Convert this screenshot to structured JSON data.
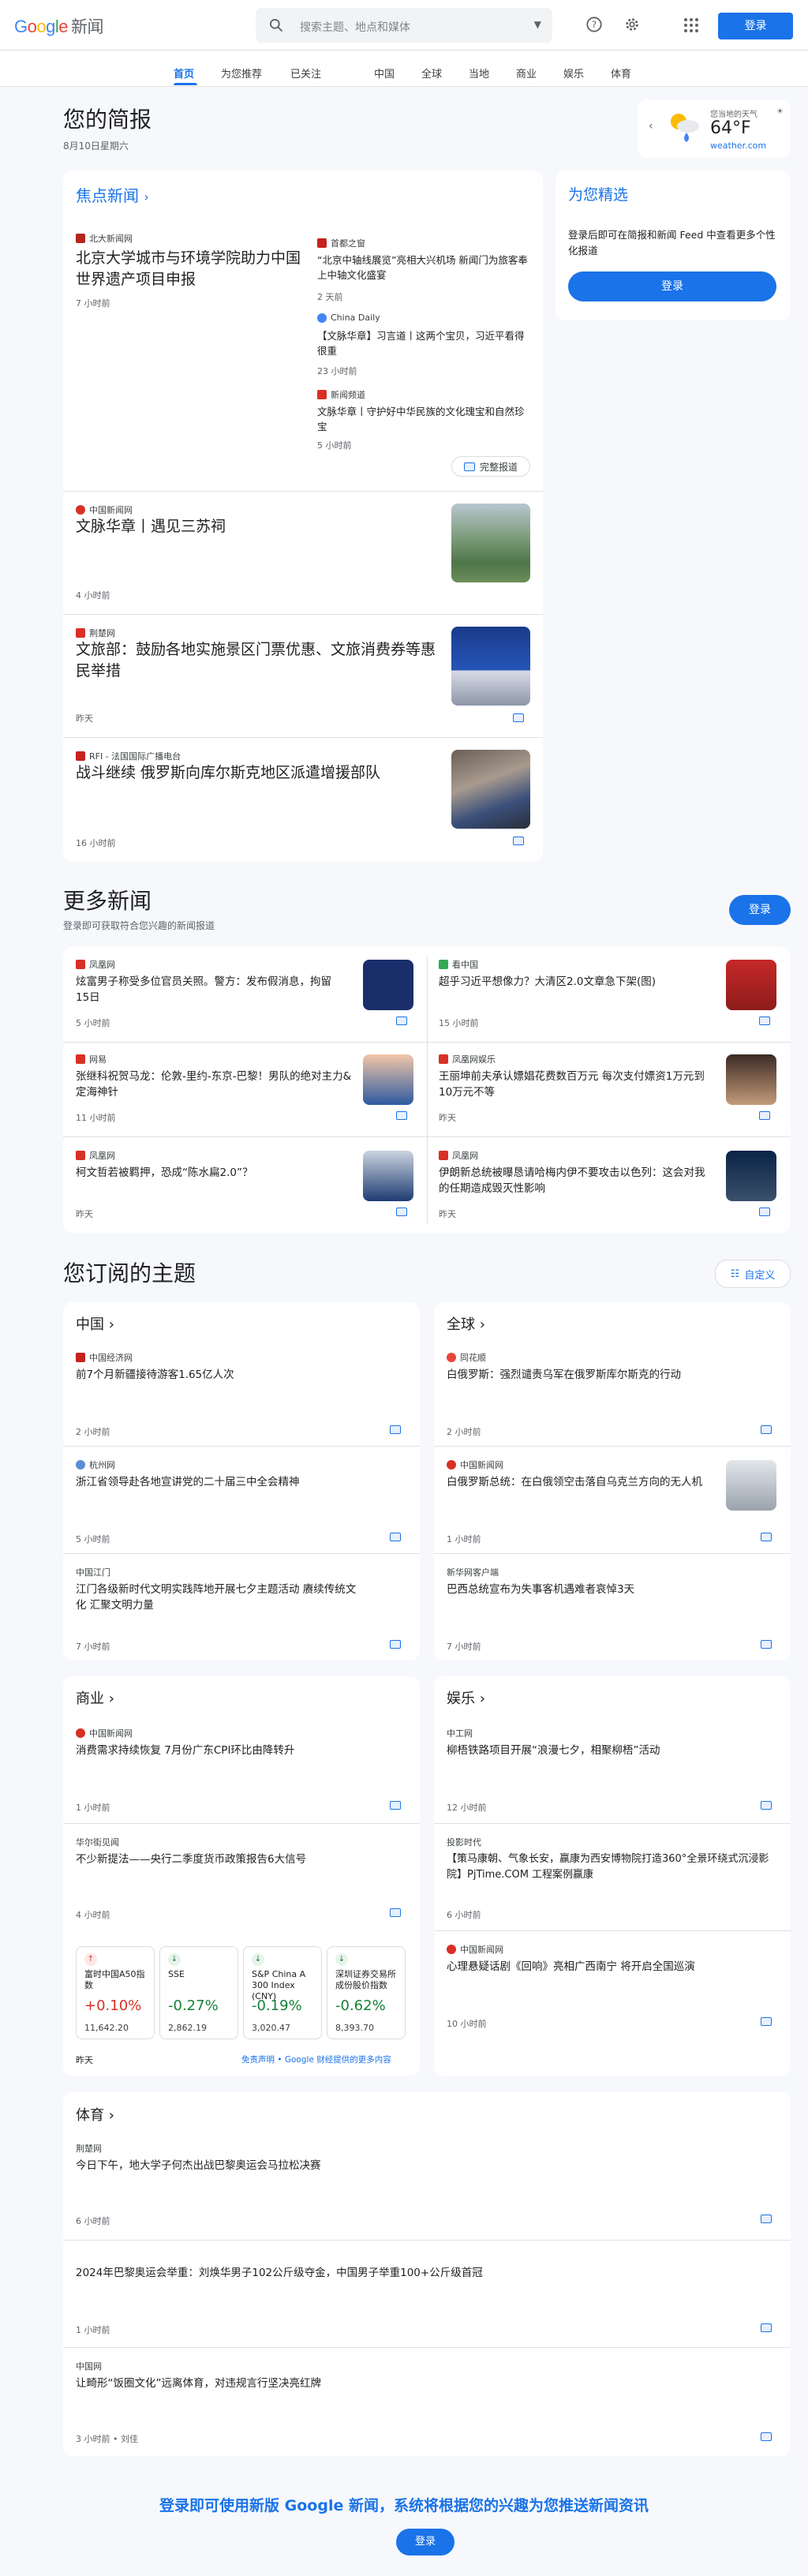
{
  "header": {
    "logo_google": "Google",
    "logo_news": "新闻",
    "search_placeholder": "搜索主题、地点和媒体",
    "signin": "登录"
  },
  "nav": {
    "tabs": [
      "首页",
      "为您推荐",
      "已关注",
      "中国",
      "全球",
      "当地",
      "商业",
      "娱乐",
      "体育"
    ]
  },
  "briefing": {
    "title": "您的简报",
    "date": "8月10日星期六"
  },
  "weather": {
    "label": "您当地的天气",
    "temp": "64°F",
    "source": "weather.com"
  },
  "headlines": {
    "title": "焦点新闻",
    "main": {
      "source": "北大新闻网",
      "title": "北京大学城市与环境学院助力中国世界遗产项目申报",
      "time": "7 小时前"
    },
    "side": [
      {
        "source": "首都之窗",
        "title": "“北京中轴线展览”亮相大兴机场 新闻门为旅客奉上中轴文化盛宴",
        "time": "2 天前"
      },
      {
        "source": "China Daily",
        "title": "【文脉华章】习言道丨这两个宝贝，习近平看得很重",
        "time": "23 小时前"
      },
      {
        "source": "新闻频道",
        "title": "文脉华章丨守护好中华民族的文化瑰宝和自然珍宝",
        "time": "5 小时前"
      }
    ],
    "full_coverage": "完整报道",
    "items": [
      {
        "source": "中国新闻网",
        "title": "文脉华章丨遇见三苏祠",
        "time": "4 小时前"
      },
      {
        "source": "荆楚网",
        "title": "文旅部：鼓励各地实施景区门票优惠、文旅消费券等惠民举措",
        "time": "昨天"
      },
      {
        "source": "RFI - 法国国际广播电台",
        "title": "战斗继续 俄罗斯向库尔斯克地区派遣增援部队",
        "time": "16 小时前"
      }
    ]
  },
  "picks": {
    "title": "为您精选",
    "desc": "登录后即可在简报和新闻 Feed 中查看更多个性化报道",
    "signin": "登录"
  },
  "more": {
    "title": "更多新闻",
    "sub": "登录即可获取符合您兴趣的新闻报道",
    "signin": "登录",
    "items": [
      {
        "source": "凤凰网",
        "title": "炫富男子称受多位官员关照。警方：发布假消息，拘留15日",
        "time": "5 小时前"
      },
      {
        "source": "看中国",
        "title": "超乎习近平想像力？大清区2.0文章急下架(图)",
        "time": "15 小时前"
      },
      {
        "source": "网易",
        "title": "张继科祝贺马龙：伦敦-里约-东京-巴黎！男队的绝对主力&定海神针",
        "time": "11 小时前"
      },
      {
        "source": "凤凰网娱乐",
        "title": "王丽坤前夫承认嫖娼花费数百万元 每次支付嫖资1万元到10万元不等",
        "time": "昨天"
      },
      {
        "source": "凤凰网",
        "title": "柯文哲若被羁押，恐成“陈水扁2.0”？",
        "time": "昨天"
      },
      {
        "source": "凤凰网",
        "title": "伊朗新总统被曝恳请哈梅内伊不要攻击以色列：这会对我的任期造成毁灭性影响",
        "time": "昨天"
      }
    ]
  },
  "topics": {
    "title": "您订阅的主题",
    "customize": "自定义",
    "china": {
      "title": "中国",
      "items": [
        {
          "source": "中国经济网",
          "title": "前7个月新疆接待游客1.65亿人次",
          "time": "2 小时前"
        },
        {
          "source": "杭州网",
          "title": "浙江省领导赴各地宣讲党的二十届三中全会精神",
          "time": "5 小时前"
        },
        {
          "source": "中国江门",
          "title": "江门各级新时代文明实践阵地开展七夕主题活动 赓续传统文化 汇聚文明力量",
          "time": "7 小时前"
        }
      ]
    },
    "world": {
      "title": "全球",
      "items": [
        {
          "source": "同花顺",
          "title": "白俄罗斯：强烈谴责乌军在俄罗斯库尔斯克的行动",
          "time": "2 小时前"
        },
        {
          "source": "中国新闻网",
          "title": "白俄罗斯总统：在白俄领空击落自乌克兰方向的无人机",
          "time": "1 小时前"
        },
        {
          "source": "新华网客户端",
          "title": "巴西总统宣布为失事客机遇难者哀悼3天",
          "time": "7 小时前"
        }
      ]
    },
    "business": {
      "title": "商业",
      "items": [
        {
          "source": "中国新闻网",
          "title": "消费需求持续恢复 7月份广东CPI环比由降转升",
          "time": "1 小时前"
        },
        {
          "source": "华尔街见闻",
          "title": "不少新提法——央行二季度货币政策报告6大信号",
          "time": "4 小时前"
        }
      ],
      "stocks": [
        {
          "name": "富时中国A50指数",
          "pct": "+0.10%",
          "value": "11,642.20",
          "dir": "up"
        },
        {
          "name": "SSE",
          "pct": "-0.27%",
          "value": "2,862.19",
          "dir": "down"
        },
        {
          "name": "S&P China A 300 Index (CNY)",
          "pct": "-0.19%",
          "value": "3,020.47",
          "dir": "down"
        },
        {
          "name": "深圳证券交易所成份股价指数",
          "pct": "-0.62%",
          "value": "8,393.70",
          "dir": "down"
        }
      ],
      "stock_time": "昨天",
      "disclaimer": "免责声明 • Google 财经提供的更多内容"
    },
    "ent": {
      "title": "娱乐",
      "items": [
        {
          "source": "中工网",
          "title": "柳梧铁路项目开展“浪漫七夕，相聚柳梧”活动",
          "time": "12 小时前"
        },
        {
          "source": "投影时代",
          "title": "【策马康朝、气象长安，赢康为西安博物院打造360°全景环绕式沉浸影院】PjTime.COM 工程案例赢康",
          "time": "6 小时前"
        },
        {
          "source": "中国新闻网",
          "title": "心理悬疑话剧《回响》亮相广西南宁 将开启全国巡演",
          "time": "10 小时前"
        }
      ]
    },
    "sports": {
      "title": "体育",
      "items": [
        {
          "source": "荆楚网",
          "title": "今日下午，地大学子何杰出战巴黎奥运会马拉松决赛",
          "time": "6 小时前"
        },
        {
          "source": "",
          "title": "2024年巴黎奥运会举重：刘焕华男子102公斤级夺金，中国男子举重100+公斤级首冠",
          "time": "1 小时前"
        },
        {
          "source": "中国网",
          "title": "让畸形“饭圈文化”远离体育，对违规言行坚决亮红牌",
          "time": "3 小时前 • 刘佳"
        }
      ]
    }
  },
  "footer": {
    "text": "登录即可使用新版 Google 新闻，系统将根据您的兴趣为您推送新闻资讯",
    "signin": "登录"
  },
  "colors": {
    "accent": "#1a73e8",
    "up": "#d93025",
    "down": "#188038"
  }
}
